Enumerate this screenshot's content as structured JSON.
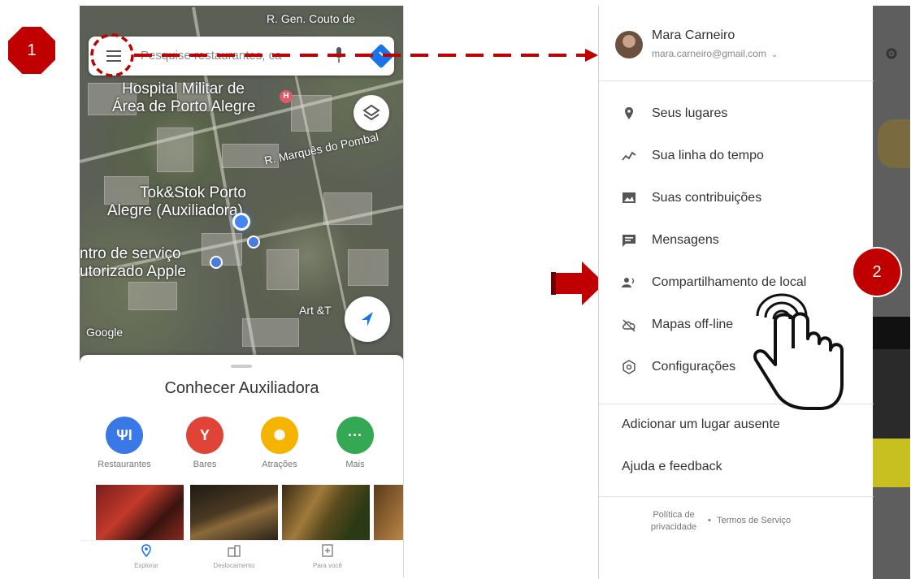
{
  "map": {
    "search_placeholder": "Pesquise restaurantes, ca",
    "labels": {
      "street_top": "R. Gen. Couto de",
      "hospital_line1": "Hospital Militar de",
      "hospital_line2": "Área de Porto Alegre",
      "street_pombal": "R. Marquês do Pombal",
      "tokstok_line1": "Tok&Stok Porto",
      "tokstok_line2": "Alegre (Auxiliadora)",
      "servico_line1": "ntro de serviço",
      "servico_line2": "utorizado Apple",
      "art": "Art &T",
      "google": "Google"
    }
  },
  "sheet": {
    "title": "Conhecer Auxiliadora",
    "categories": [
      {
        "label": "Restaurantes",
        "icon": "fork-knife-icon",
        "color": "#3b78e7",
        "glyph": "ΨΙ"
      },
      {
        "label": "Bares",
        "icon": "cocktail-icon",
        "color": "#e04436",
        "glyph": "Y"
      },
      {
        "label": "Atrações",
        "icon": "attractions-icon",
        "color": "#f4b400",
        "glyph": "✺"
      },
      {
        "label": "Mais",
        "icon": "more-icon",
        "color": "#34a853",
        "glyph": "···"
      }
    ]
  },
  "bottom_nav": [
    {
      "label": "Explorar",
      "icon": "location-pin-icon"
    },
    {
      "label": "Deslocamento",
      "icon": "commute-icon"
    },
    {
      "label": "Para você",
      "icon": "for-you-icon"
    }
  ],
  "annotations": {
    "step1": "1",
    "step2": "2"
  },
  "drawer": {
    "user_name": "Mara Carneiro",
    "user_email": "mara.carneiro@gmail.com",
    "items": [
      {
        "label": "Seus lugares",
        "icon": "place-pin-icon"
      },
      {
        "label": "Sua linha do tempo",
        "icon": "timeline-icon"
      },
      {
        "label": "Suas contribuições",
        "icon": "contributions-icon"
      },
      {
        "label": "Mensagens",
        "icon": "messages-icon"
      },
      {
        "label": "Compartilhamento de local",
        "icon": "location-sharing-icon"
      },
      {
        "label": "Mapas off-line",
        "icon": "offline-cloud-icon"
      },
      {
        "label": "Configurações",
        "icon": "settings-gear-icon"
      }
    ],
    "add_place": "Adicionar um lugar ausente",
    "help": "Ajuda e feedback",
    "privacy_line1": "Política de",
    "privacy_line2": "privacidade",
    "separator": "•",
    "terms": "Termos de Serviço"
  },
  "colors": {
    "accent_red": "#c00000",
    "google_blue": "#4285f4"
  }
}
